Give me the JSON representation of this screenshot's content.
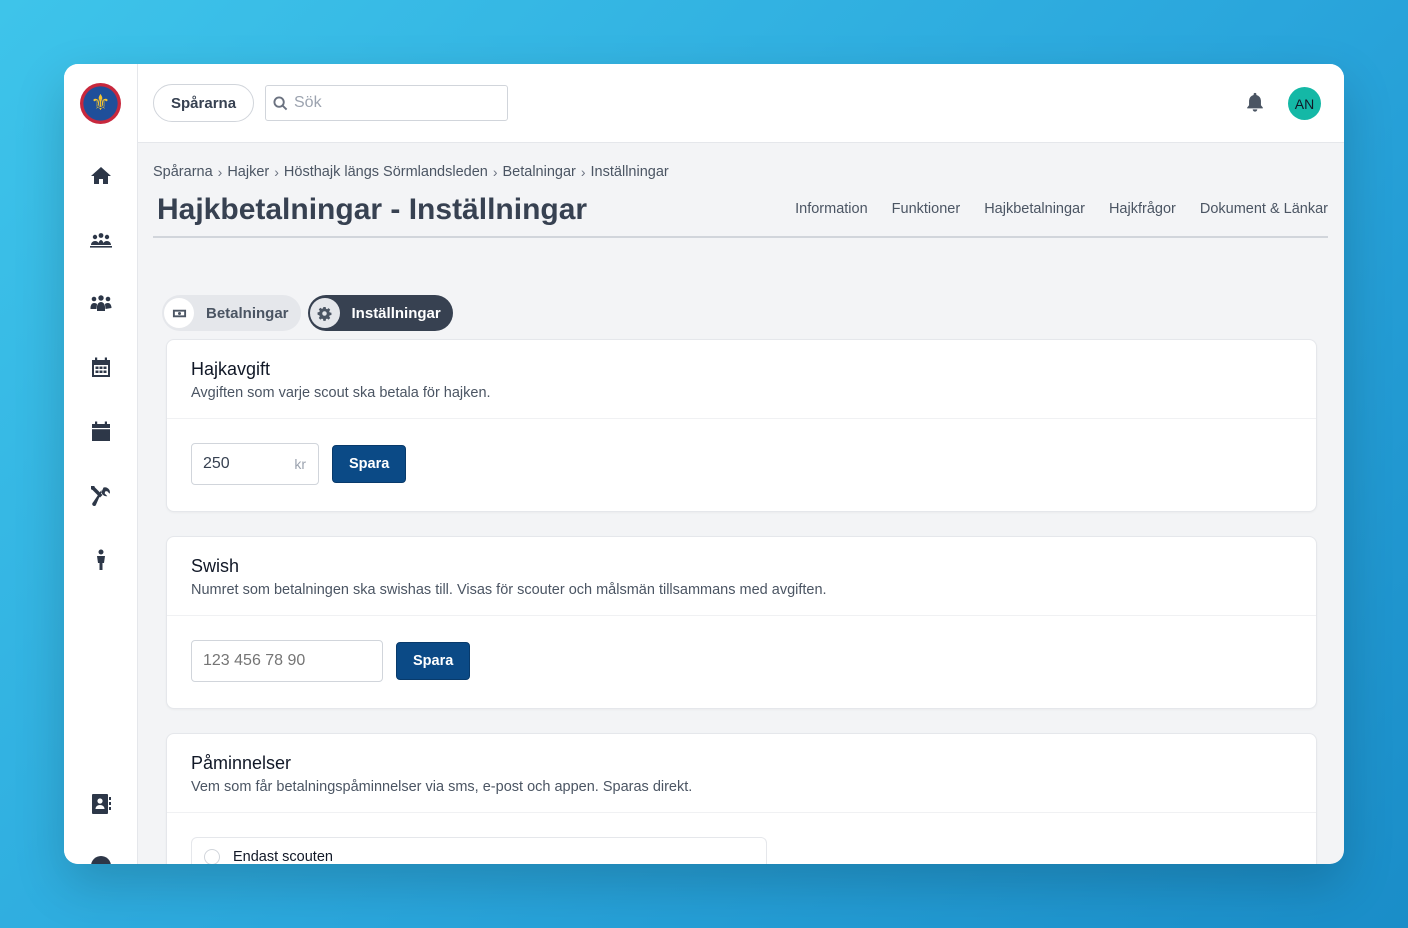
{
  "app": {
    "group_name": "Spårarna",
    "search_placeholder": "Sök",
    "avatar_initials": "AN"
  },
  "sidebar": {
    "items": [
      {
        "name": "home-icon"
      },
      {
        "name": "troops-icon"
      },
      {
        "name": "people-icon"
      },
      {
        "name": "calendar-grid-icon"
      },
      {
        "name": "calendar-icon"
      },
      {
        "name": "tools-icon"
      },
      {
        "name": "person-icon"
      },
      {
        "name": "contacts-icon"
      },
      {
        "name": "globe-icon"
      }
    ]
  },
  "breadcrumb": [
    "Spårarna",
    "Hajker",
    "Hösthajk längs Sörmlandsleden",
    "Betalningar",
    "Inställningar"
  ],
  "page": {
    "title": "Hajkbetalningar - Inställningar",
    "tabs": [
      "Information",
      "Funktioner",
      "Hajkbetalningar",
      "Hajkfrågor",
      "Dokument & Länkar"
    ]
  },
  "subtabs": {
    "payments_label": "Betalningar",
    "settings_label": "Inställningar"
  },
  "fee_card": {
    "title": "Hajkavgift",
    "description": "Avgiften som varje scout ska betala för hajken.",
    "value": "250",
    "unit": "kr",
    "button": "Spara"
  },
  "swish_card": {
    "title": "Swish",
    "description": "Numret som betalningen ska swishas till. Visas för scouter och målsmän tillsammans med avgiften.",
    "placeholder": "123 456 78 90",
    "button": "Spara"
  },
  "reminders_card": {
    "title": "Påminnelser",
    "description": "Vem som får betalningspåminnelser via sms, e-post och appen. Sparas direkt.",
    "option_1": "Endast scouten"
  }
}
